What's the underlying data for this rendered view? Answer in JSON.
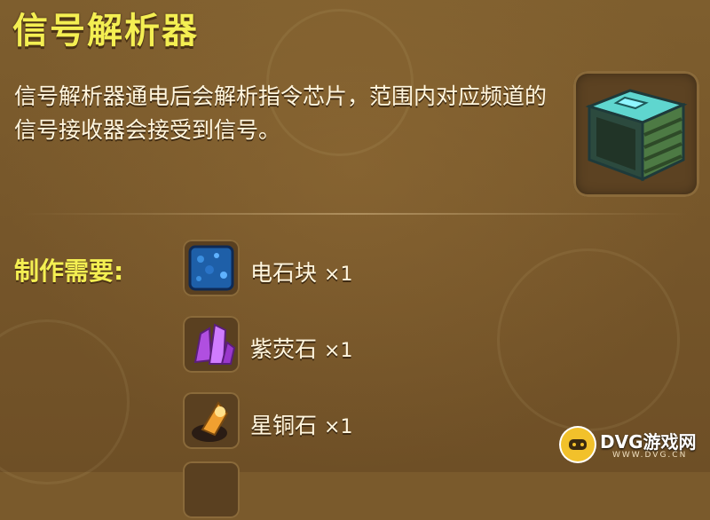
{
  "item": {
    "title": "信号解析器",
    "description": "信号解析器通电后会解析指令芯片，范围内对应频道的信号接收器会接受到信号。",
    "icon": "signal-parser-block-icon"
  },
  "requirements": {
    "label": "制作需要:",
    "materials": [
      {
        "name": "电石块",
        "qty": "×1",
        "icon": "electric-stone-block-icon"
      },
      {
        "name": "紫荧石",
        "qty": "×1",
        "icon": "purple-fluorite-crystal-icon"
      },
      {
        "name": "星铜石",
        "qty": "×1",
        "icon": "star-copper-ore-icon"
      }
    ]
  },
  "watermark": {
    "text": "DVG游戏网",
    "sub": "WWW.DVG.CN"
  },
  "colors": {
    "background": "#7a5a2c",
    "title": "#f4ef52",
    "text": "#fff6df"
  }
}
